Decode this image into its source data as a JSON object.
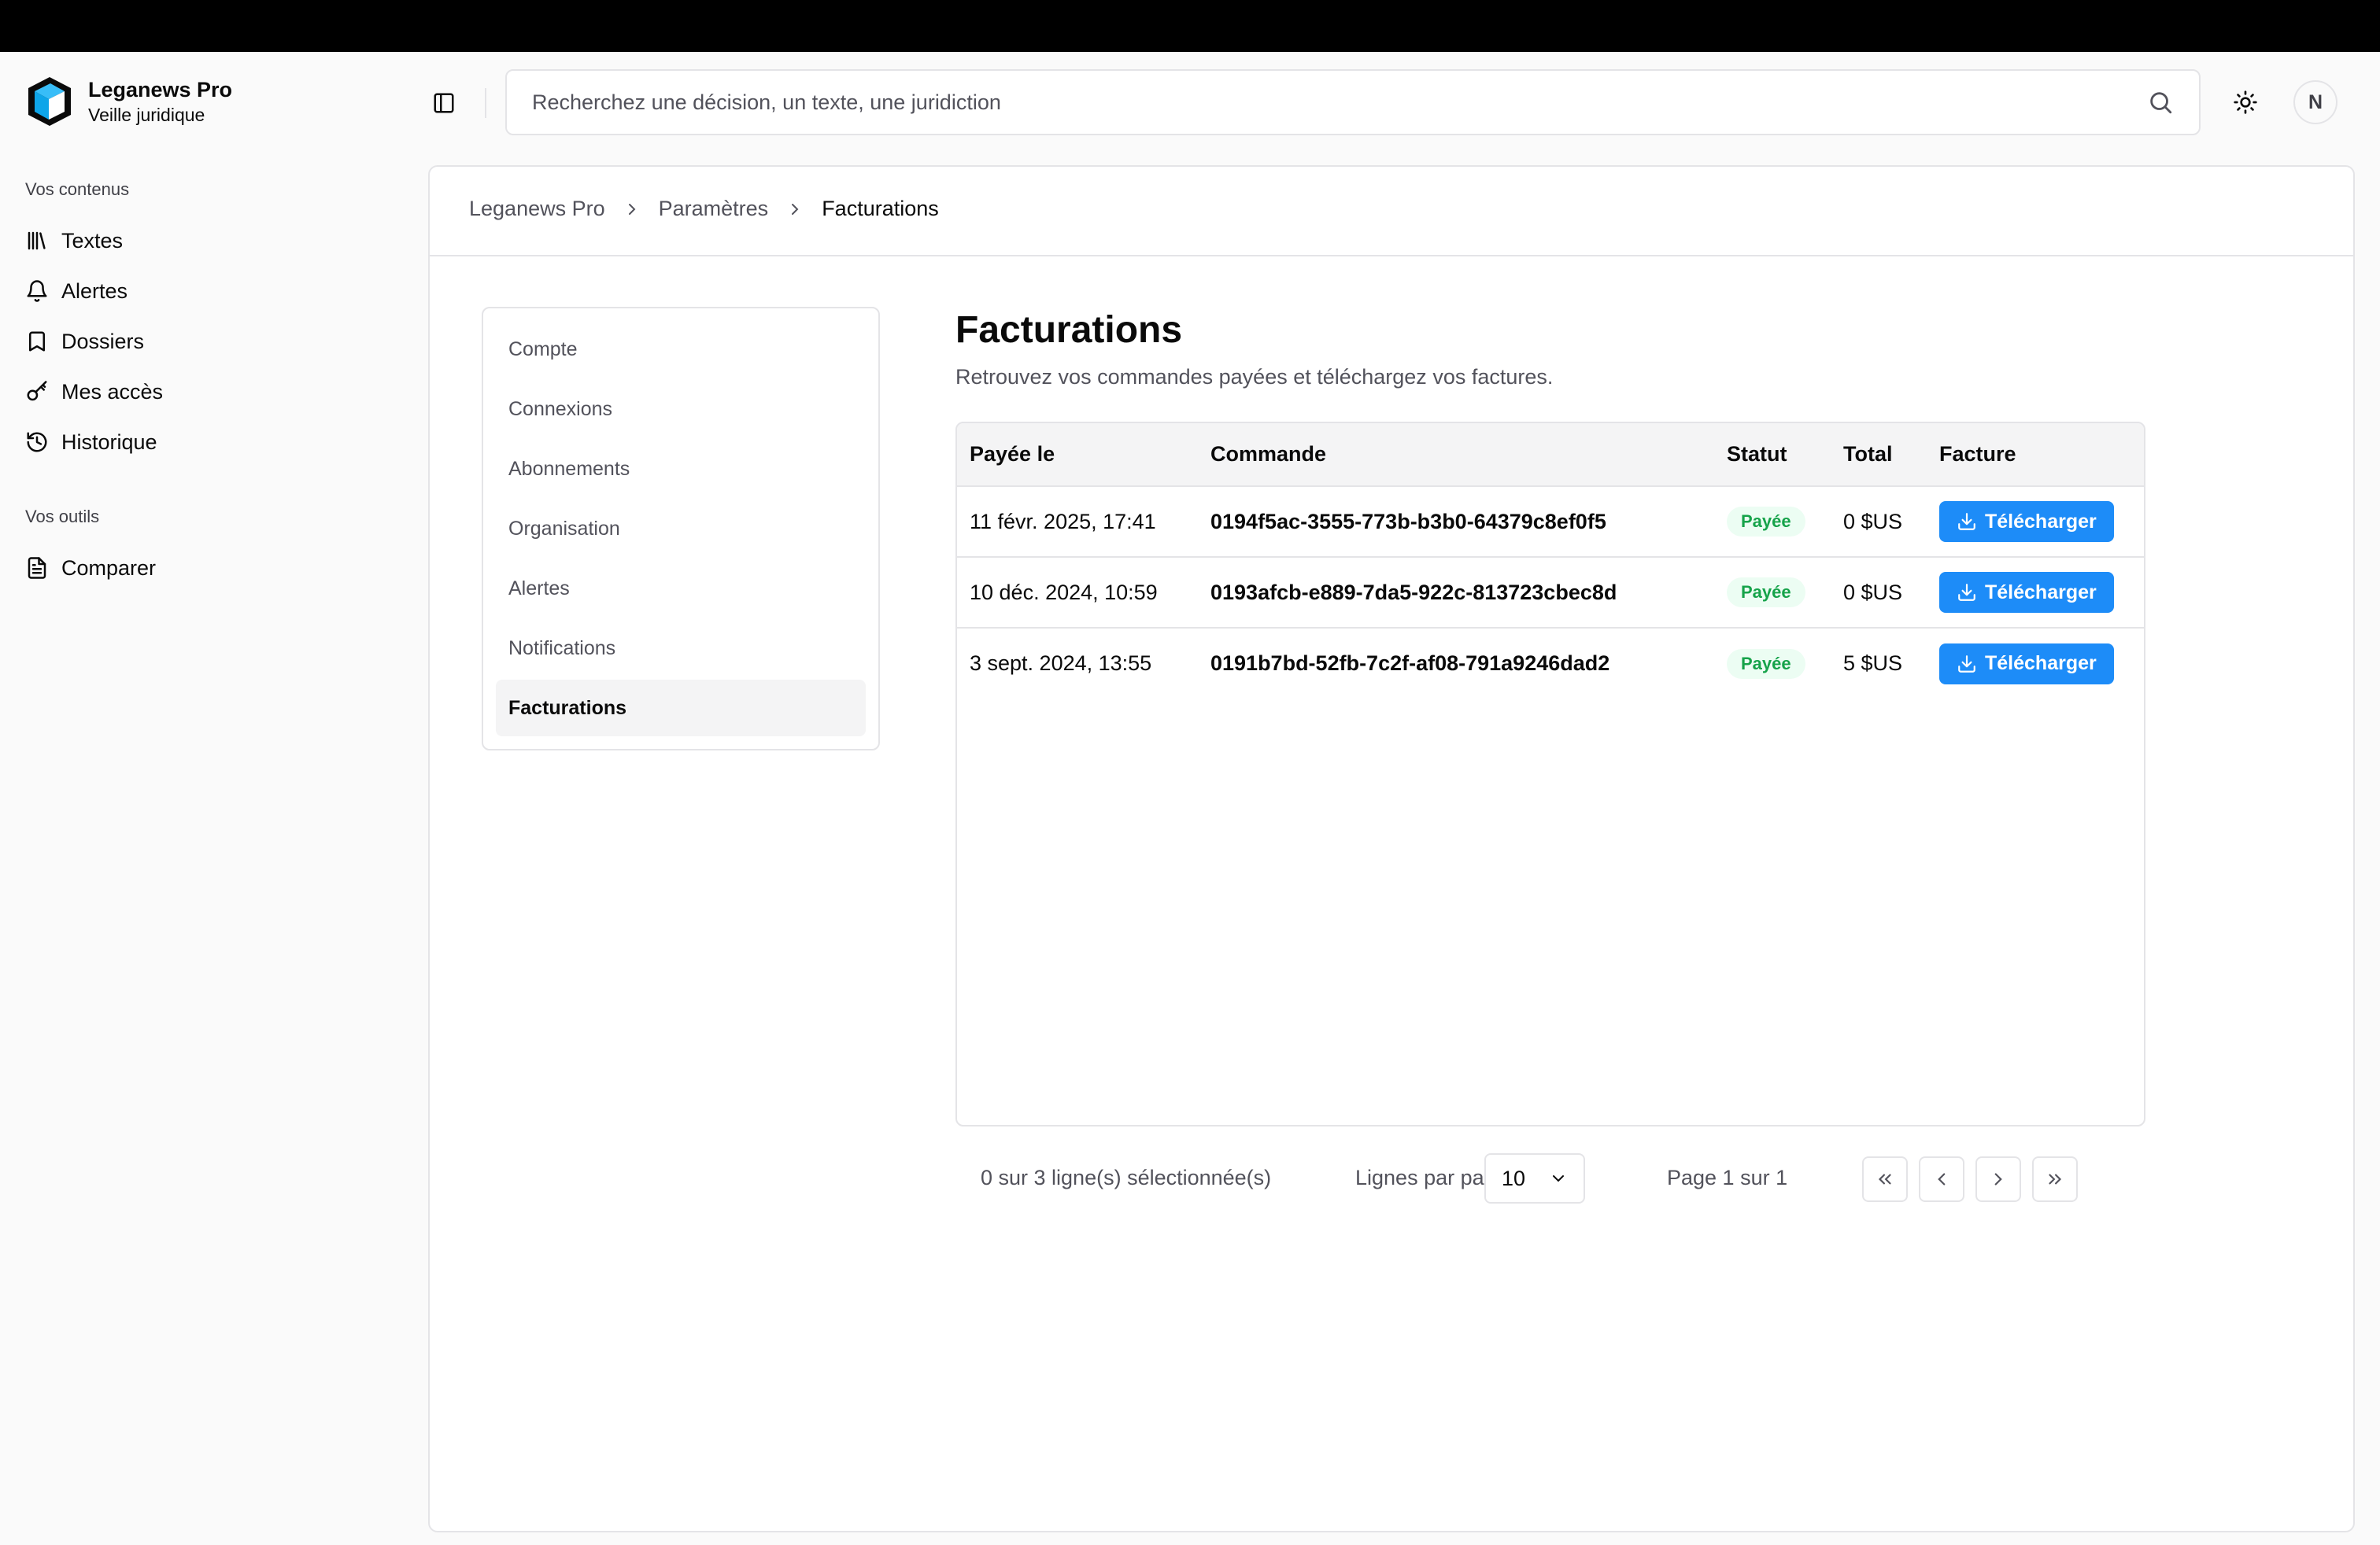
{
  "app": {
    "name": "Leganews Pro",
    "subtitle": "Veille juridique"
  },
  "sidebar": {
    "groups": [
      {
        "title": "Vos contenus",
        "items": [
          {
            "label": "Textes",
            "icon": "library-icon"
          },
          {
            "label": "Alertes",
            "icon": "bell-icon"
          },
          {
            "label": "Dossiers",
            "icon": "bookmark-icon"
          },
          {
            "label": "Mes accès",
            "icon": "key-icon"
          },
          {
            "label": "Historique",
            "icon": "history-icon"
          }
        ]
      },
      {
        "title": "Vos outils",
        "items": [
          {
            "label": "Comparer",
            "icon": "file-text-icon"
          }
        ]
      }
    ]
  },
  "header": {
    "search_placeholder": "Recherchez une décision, un texte, une juridiction",
    "avatar_initial": "N"
  },
  "breadcrumb": [
    "Leganews Pro",
    "Paramètres",
    "Facturations"
  ],
  "settings_nav": [
    "Compte",
    "Connexions",
    "Abonnements",
    "Organisation",
    "Alertes",
    "Notifications",
    "Facturations"
  ],
  "settings_nav_active": "Facturations",
  "page": {
    "title": "Facturations",
    "description": "Retrouvez vos commandes payées et téléchargez vos factures."
  },
  "table": {
    "columns": [
      "Payée le",
      "Commande",
      "Statut",
      "Total",
      "Facture"
    ],
    "rows": [
      {
        "date": "11 févr. 2025, 17:41",
        "order": "0194f5ac-3555-773b-b3b0-64379c8ef0f5",
        "status": "Payée",
        "total": "0 $US",
        "action": "Télécharger"
      },
      {
        "date": "10 déc. 2024, 10:59",
        "order": "0193afcb-e889-7da5-922c-813723cbec8d",
        "status": "Payée",
        "total": "0 $US",
        "action": "Télécharger"
      },
      {
        "date": "3 sept. 2024, 13:55",
        "order": "0191b7bd-52fb-7c2f-af08-791a9246dad2",
        "status": "Payée",
        "total": "5 $US",
        "action": "Télécharger"
      }
    ]
  },
  "pagination": {
    "selected_text": "0 sur 3 ligne(s) sélectionnée(s)",
    "rows_per_page_label": "Lignes par page",
    "rows_per_page_value": "10",
    "page_info": "Page 1 sur 1"
  },
  "colors": {
    "accent": "#1d8cf8",
    "status_paid_text": "#16a34a",
    "status_paid_bg": "#ecfdf3"
  }
}
